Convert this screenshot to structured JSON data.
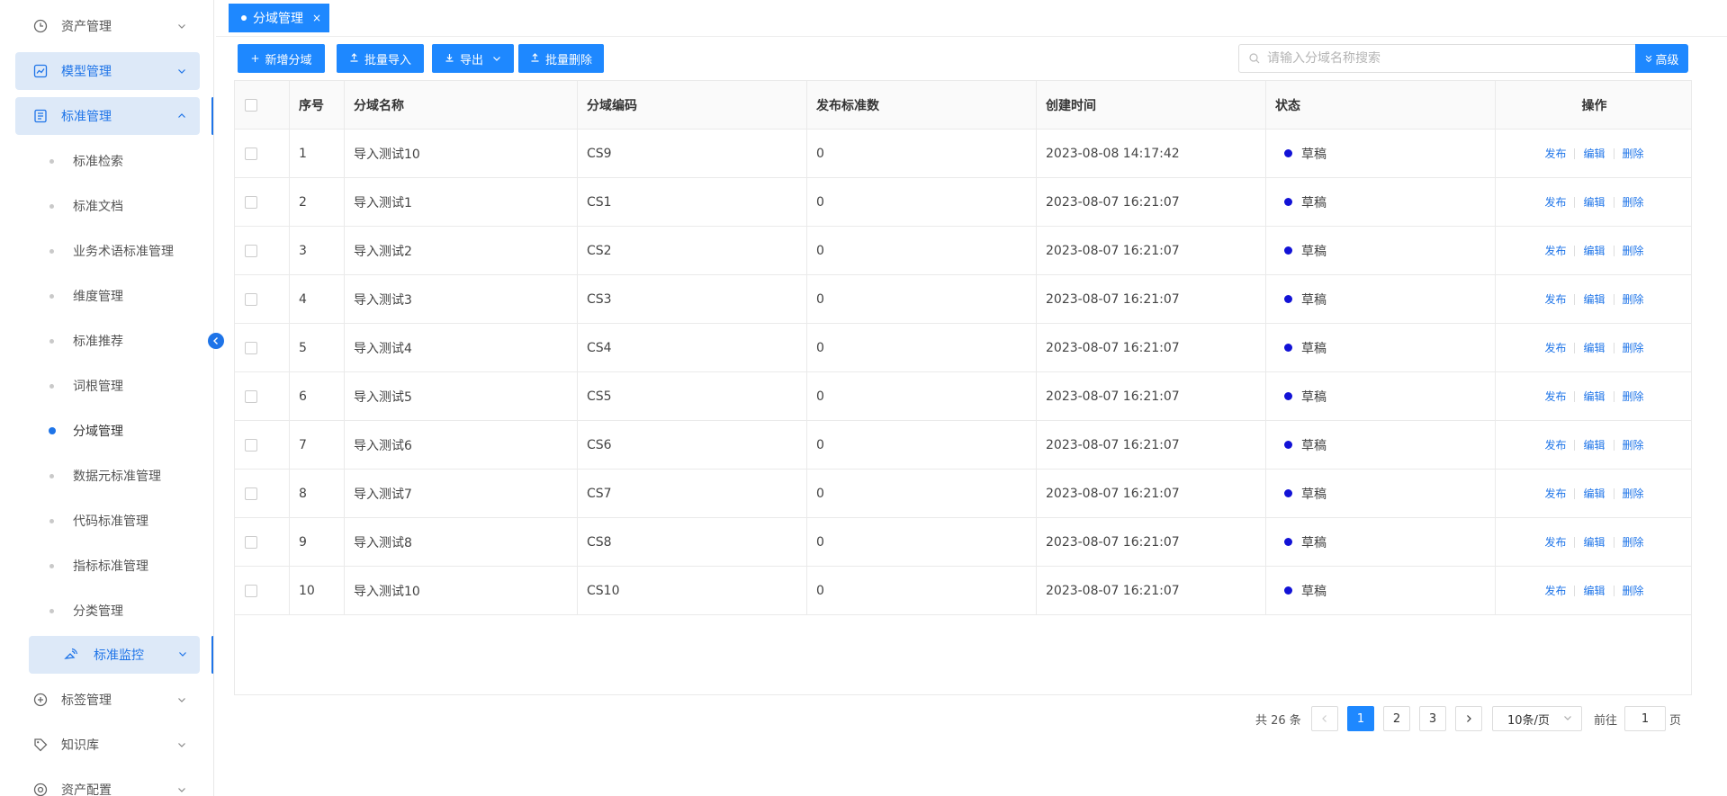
{
  "sidebar": {
    "menus": [
      {
        "label": "资产管理",
        "icon": "clock-icon"
      },
      {
        "label": "模型管理",
        "icon": "chart-icon"
      },
      {
        "label": "标准管理",
        "icon": "document-icon"
      },
      {
        "label": "标签管理",
        "icon": "plus-circle-icon"
      },
      {
        "label": "知识库",
        "icon": "tag-icon"
      },
      {
        "label": "资产配置",
        "icon": "settings-icon"
      }
    ],
    "sub_items": [
      "标准检索",
      "标准文档",
      "业务术语标准管理",
      "维度管理",
      "标准推荐",
      "词根管理",
      "分域管理",
      "数据元标准管理",
      "代码标准管理",
      "指标标准管理",
      "分类管理"
    ],
    "monitor_label": "标准监控"
  },
  "tab": {
    "label": "分域管理",
    "close": "×"
  },
  "toolbar": {
    "add_label": "新增分域",
    "import_label": "批量导入",
    "export_label": "导出",
    "delete_label": "批量删除",
    "search_placeholder": "请输入分域名称搜索",
    "advanced_label": "高级"
  },
  "table": {
    "headers": [
      "序号",
      "分域名称",
      "分域编码",
      "发布标准数",
      "创建时间",
      "状态",
      "操作"
    ],
    "rows": [
      {
        "no": "1",
        "name": "导入测试10",
        "code": "CS9",
        "count": "0",
        "time": "2023-08-08 14:17:42",
        "status": "草稿"
      },
      {
        "no": "2",
        "name": "导入测试1",
        "code": "CS1",
        "count": "0",
        "time": "2023-08-07 16:21:07",
        "status": "草稿"
      },
      {
        "no": "3",
        "name": "导入测试2",
        "code": "CS2",
        "count": "0",
        "time": "2023-08-07 16:21:07",
        "status": "草稿"
      },
      {
        "no": "4",
        "name": "导入测试3",
        "code": "CS3",
        "count": "0",
        "time": "2023-08-07 16:21:07",
        "status": "草稿"
      },
      {
        "no": "5",
        "name": "导入测试4",
        "code": "CS4",
        "count": "0",
        "time": "2023-08-07 16:21:07",
        "status": "草稿"
      },
      {
        "no": "6",
        "name": "导入测试5",
        "code": "CS5",
        "count": "0",
        "time": "2023-08-07 16:21:07",
        "status": "草稿"
      },
      {
        "no": "7",
        "name": "导入测试6",
        "code": "CS6",
        "count": "0",
        "time": "2023-08-07 16:21:07",
        "status": "草稿"
      },
      {
        "no": "8",
        "name": "导入测试7",
        "code": "CS7",
        "count": "0",
        "time": "2023-08-07 16:21:07",
        "status": "草稿"
      },
      {
        "no": "9",
        "name": "导入测试8",
        "code": "CS8",
        "count": "0",
        "time": "2023-08-07 16:21:07",
        "status": "草稿"
      },
      {
        "no": "10",
        "name": "导入测试10",
        "code": "CS10",
        "count": "0",
        "time": "2023-08-07 16:21:07",
        "status": "草稿"
      }
    ],
    "ops": [
      "发布",
      "编辑",
      "删除"
    ]
  },
  "pagination": {
    "total": "共 26 条",
    "pages": [
      "1",
      "2",
      "3"
    ],
    "page_size": "10条/页",
    "goto_label": "前往",
    "goto_value": "1",
    "page_unit": "页"
  },
  "colors": {
    "accent": "#1e88ff",
    "status_dot": "#1212d6",
    "active_bg": "#dde9f8"
  }
}
